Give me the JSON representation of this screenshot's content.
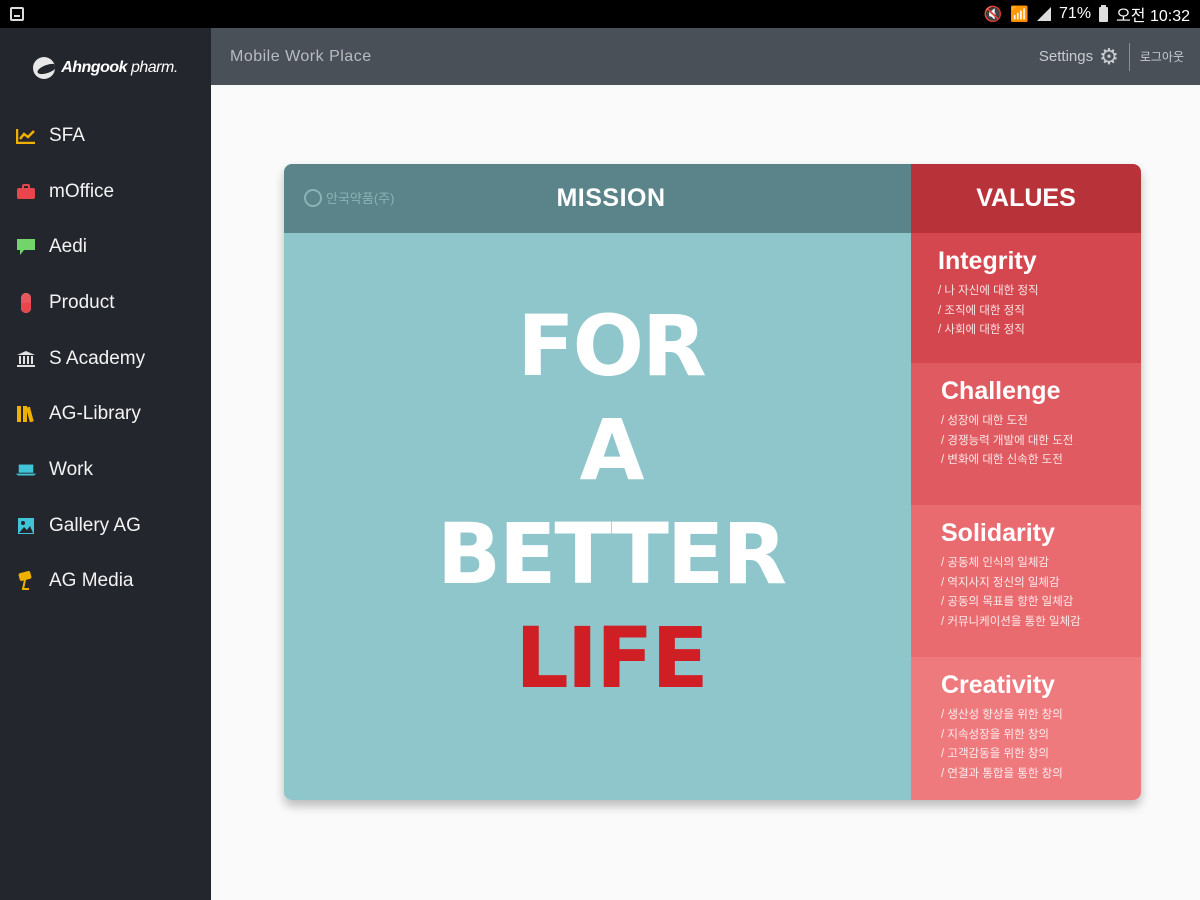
{
  "status_bar": {
    "battery_percent": "71%",
    "time": "오전 10:32"
  },
  "sidebar": {
    "logo": {
      "brand": "Ahngook",
      "suffix": " pharm."
    },
    "items": [
      {
        "label": "SFA",
        "icon": "chart-icon",
        "color": "#f0b000"
      },
      {
        "label": "mOffice",
        "icon": "briefcase-icon",
        "color": "#e8464c"
      },
      {
        "label": "Aedi",
        "icon": "chat-bubble-icon",
        "color": "#72d56a"
      },
      {
        "label": "Product",
        "icon": "capsule-icon",
        "color": "#e8464c"
      },
      {
        "label": "S Academy",
        "icon": "institution-icon",
        "color": "#e0e0e0"
      },
      {
        "label": "AG-Library",
        "icon": "books-icon",
        "color": "#f0b000"
      },
      {
        "label": "Work",
        "icon": "laptop-icon",
        "color": "#3fc4d8"
      },
      {
        "label": "Gallery AG",
        "icon": "picture-icon",
        "color": "#3fc4d8"
      },
      {
        "label": "AG Media",
        "icon": "camera-icon",
        "color": "#f0b000"
      }
    ]
  },
  "header": {
    "title": "Mobile Work Place",
    "settings_label": "Settings",
    "logout_label": "로그아웃"
  },
  "mission_card": {
    "company_logo_text": "안국약품(주)",
    "mission_title": "MISSION",
    "slogan": [
      "FOR",
      "A",
      "BETTER",
      "LIFE"
    ],
    "values_title": "VALUES",
    "values": [
      {
        "name": "Integrity",
        "color": "#d5474f",
        "lines": [
          "/ 나 자신에 대한 정직",
          "/ 조직에 대한 정직",
          "/ 사회에 대한 정직"
        ]
      },
      {
        "name": "Challenge",
        "color": "#e05b61",
        "lines": [
          "/ 성장에 대한 도전",
          "/ 경쟁능력 개발에 대한 도전",
          "/ 변화에 대한 신속한 도전"
        ]
      },
      {
        "name": "Solidarity",
        "color": "#e96b70",
        "lines": [
          "/ 공동체 인식의 일체감",
          "/ 역지사지 정신의 일체감",
          "/ 공동의 목표를 향한 일체감",
          "/ 커뮤니케이션을 통한 일체감"
        ]
      },
      {
        "name": "Creativity",
        "color": "#ef7a7e",
        "lines": [
          "/ 생산성 향상을 위한 창의",
          "/ 지속성장을 위한 창의",
          "/ 고객감동을 위한 창의",
          "/ 연결과 통합을 통한 창의"
        ]
      }
    ],
    "colors": {
      "mission_bg": "#8fc6cc",
      "mission_head": "#5a8489",
      "values_head": "#b83239",
      "slogan_accent": "#d01f24"
    }
  }
}
